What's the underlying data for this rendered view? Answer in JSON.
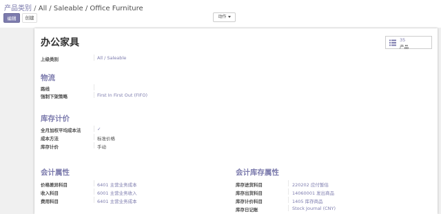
{
  "breadcrumb": {
    "root": "产品类别",
    "separator": " / ",
    "path": "All / Saleable / Office Furniture"
  },
  "toolbar": {
    "edit_label": "编辑",
    "create_label": "创建",
    "action_label": "动作"
  },
  "record": {
    "title": "办公家具",
    "stat_button": {
      "count": "35",
      "label": "产品",
      "icon": "list-icon"
    },
    "parent_category": {
      "label": "上级类别",
      "value": "All / Saleable"
    }
  },
  "logistics": {
    "title": "物流",
    "routes": {
      "label": "路线",
      "value": ""
    },
    "removal_strategy": {
      "label": "强制下架策略",
      "value": "First In First Out (FIFO)"
    }
  },
  "inventory_valuation": {
    "title": "库存计价",
    "avco_all": {
      "label": "全月加权平均成本法",
      "value": "✓"
    },
    "cost_method": {
      "label": "成本方法",
      "value": "标准价格"
    },
    "valuation": {
      "label": "库存计价",
      "value": "手动"
    }
  },
  "account_properties": {
    "title": "会计属性",
    "price_difference": {
      "label": "价格差异科目",
      "value": "6401 主营业务成本"
    },
    "income": {
      "label": "收入科目",
      "value": "6001 主营业务收入"
    },
    "expense": {
      "label": "费用科目",
      "value": "6401 主营业务成本"
    }
  },
  "account_stock_properties": {
    "title": "会计库存属性",
    "stock_input": {
      "label": "库存进货科目",
      "value": "220202 应付暂估"
    },
    "stock_output": {
      "label": "库存出货科目",
      "value": "14060001 发出商品"
    },
    "stock_valuation": {
      "label": "库存计价科目",
      "value": "1405 库存商品"
    },
    "stock_journal": {
      "label": "库存日记账",
      "value": "Stock Journal (CNY)"
    }
  },
  "colors": {
    "accent": "#7c7bad",
    "text": "#4c4c4c",
    "background": "#f0f0f0"
  }
}
